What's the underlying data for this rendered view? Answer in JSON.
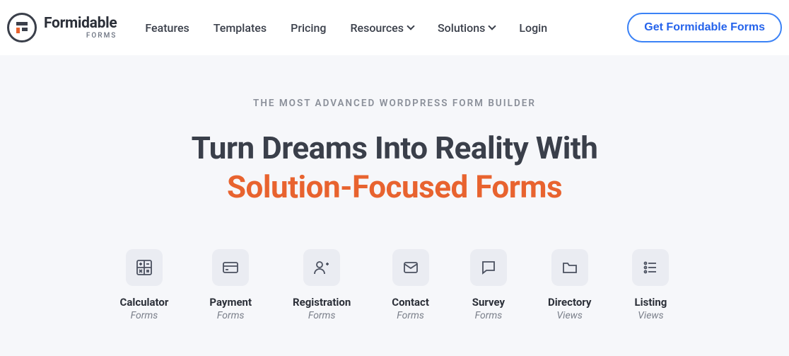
{
  "logo": {
    "main": "Formidable",
    "sub": "FORMS"
  },
  "nav": {
    "features": "Features",
    "templates": "Templates",
    "pricing": "Pricing",
    "resources": "Resources",
    "solutions": "Solutions",
    "login": "Login",
    "cta": "Get Formidable Forms"
  },
  "hero": {
    "eyebrow": "THE MOST ADVANCED WORDPRESS FORM BUILDER",
    "line1": "Turn Dreams Into Reality With",
    "line2": "Solution-Focused Forms"
  },
  "cards": [
    {
      "title": "Calculator",
      "sub": "Forms"
    },
    {
      "title": "Payment",
      "sub": "Forms"
    },
    {
      "title": "Registration",
      "sub": "Forms"
    },
    {
      "title": "Contact",
      "sub": "Forms"
    },
    {
      "title": "Survey",
      "sub": "Forms"
    },
    {
      "title": "Directory",
      "sub": "Views"
    },
    {
      "title": "Listing",
      "sub": "Views"
    }
  ]
}
